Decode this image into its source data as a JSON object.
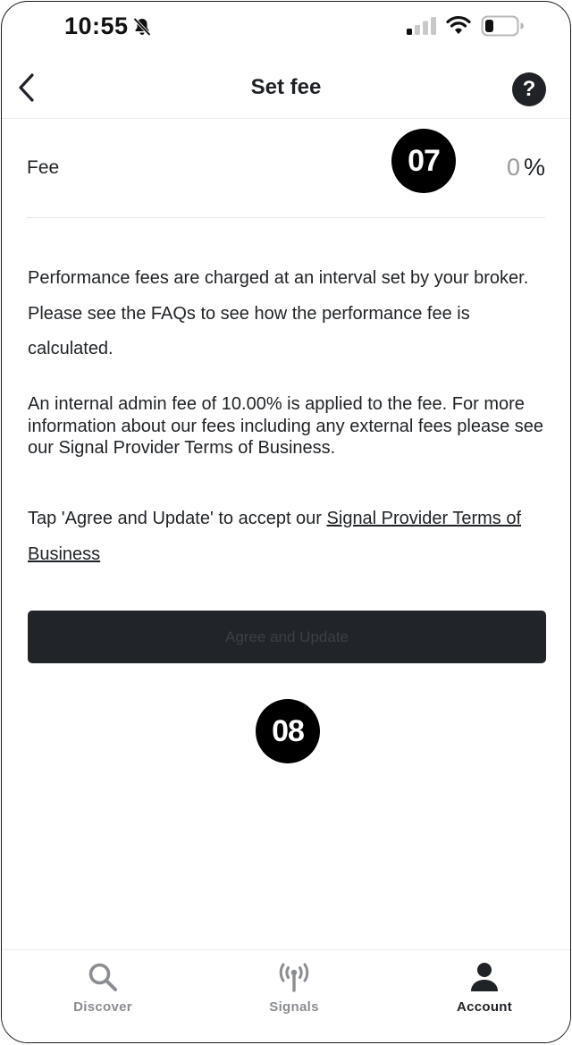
{
  "status_bar": {
    "time": "10:55"
  },
  "header": {
    "title": "Set fee",
    "help_symbol": "?"
  },
  "fee": {
    "label": "Fee",
    "value": "0",
    "unit": "%"
  },
  "badges": {
    "first": "07",
    "second": "08"
  },
  "paragraphs": {
    "interval": "Performance fees are charged at an interval set by your broker. Please see the FAQs to see how the performance fee is calculated.",
    "admin_fee": "An internal admin fee of 10.00% is applied to the fee. For more information about our fees including any external fees please see our Signal Provider Terms of Business.",
    "agree_prefix": "Tap 'Agree and Update' to accept our ",
    "terms_link": "Signal Provider Terms of Business"
  },
  "actions": {
    "agree_label": "Agree and Update"
  },
  "tab_bar": {
    "items": [
      {
        "label": "Discover",
        "icon": "search-icon",
        "active": false
      },
      {
        "label": "Signals",
        "icon": "signal-antenna-icon",
        "active": false
      },
      {
        "label": "Account",
        "icon": "person-icon",
        "active": true
      }
    ]
  },
  "colors": {
    "primary_dark": "#212529",
    "badge": "#000000",
    "inactive_tab": "#8a8d91",
    "muted_value": "#9a9a9a"
  }
}
